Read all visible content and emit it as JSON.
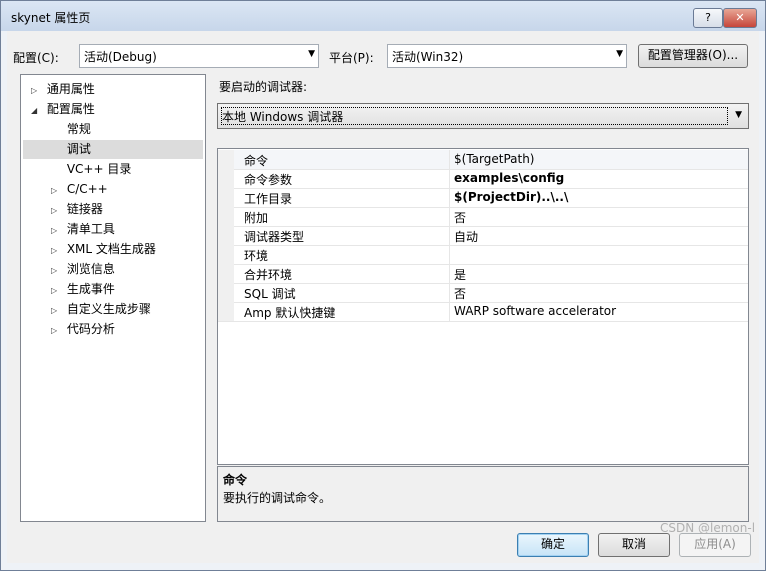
{
  "window": {
    "title": "skynet 属性页",
    "help": "?",
    "close": "✕"
  },
  "config": {
    "label": "配置(C):",
    "value": "活动(Debug)"
  },
  "platform": {
    "label": "平台(P):",
    "value": "活动(Win32)"
  },
  "config_manager_label": "配置管理器(O)...",
  "tree": [
    {
      "label": "通用属性",
      "expander": "▷"
    },
    {
      "label": "配置属性",
      "expander": "◢"
    },
    {
      "label": "常规",
      "expander": ""
    },
    {
      "label": "调试",
      "expander": "",
      "selected": true
    },
    {
      "label": "VC++ 目录",
      "expander": ""
    },
    {
      "label": "C/C++",
      "expander": "▷"
    },
    {
      "label": "链接器",
      "expander": "▷"
    },
    {
      "label": "清单工具",
      "expander": "▷"
    },
    {
      "label": "XML 文档生成器",
      "expander": "▷"
    },
    {
      "label": "浏览信息",
      "expander": "▷"
    },
    {
      "label": "生成事件",
      "expander": "▷"
    },
    {
      "label": "自定义生成步骤",
      "expander": "▷"
    },
    {
      "label": "代码分析",
      "expander": "▷"
    }
  ],
  "debugger": {
    "label": "要启动的调试器:",
    "value": "本地 Windows 调试器"
  },
  "properties": [
    {
      "name": "命令",
      "value": "$(TargetPath)",
      "bold": false
    },
    {
      "name": "命令参数",
      "value": "examples\\config",
      "bold": true
    },
    {
      "name": "工作目录",
      "value": "$(ProjectDir)..\\..\\",
      "bold": true
    },
    {
      "name": "附加",
      "value": "否",
      "bold": false
    },
    {
      "name": "调试器类型",
      "value": "自动",
      "bold": false
    },
    {
      "name": "环境",
      "value": "",
      "bold": false
    },
    {
      "name": "合并环境",
      "value": "是",
      "bold": false
    },
    {
      "name": "SQL 调试",
      "value": "否",
      "bold": false
    },
    {
      "name": "Amp 默认快捷键",
      "value": "WARP software accelerator",
      "bold": false
    }
  ],
  "description": {
    "title": "命令",
    "text": "要执行的调试命令。"
  },
  "buttons": {
    "ok": "确定",
    "cancel": "取消",
    "apply": "应用(A)"
  },
  "watermark": "CSDN @lemon-l"
}
